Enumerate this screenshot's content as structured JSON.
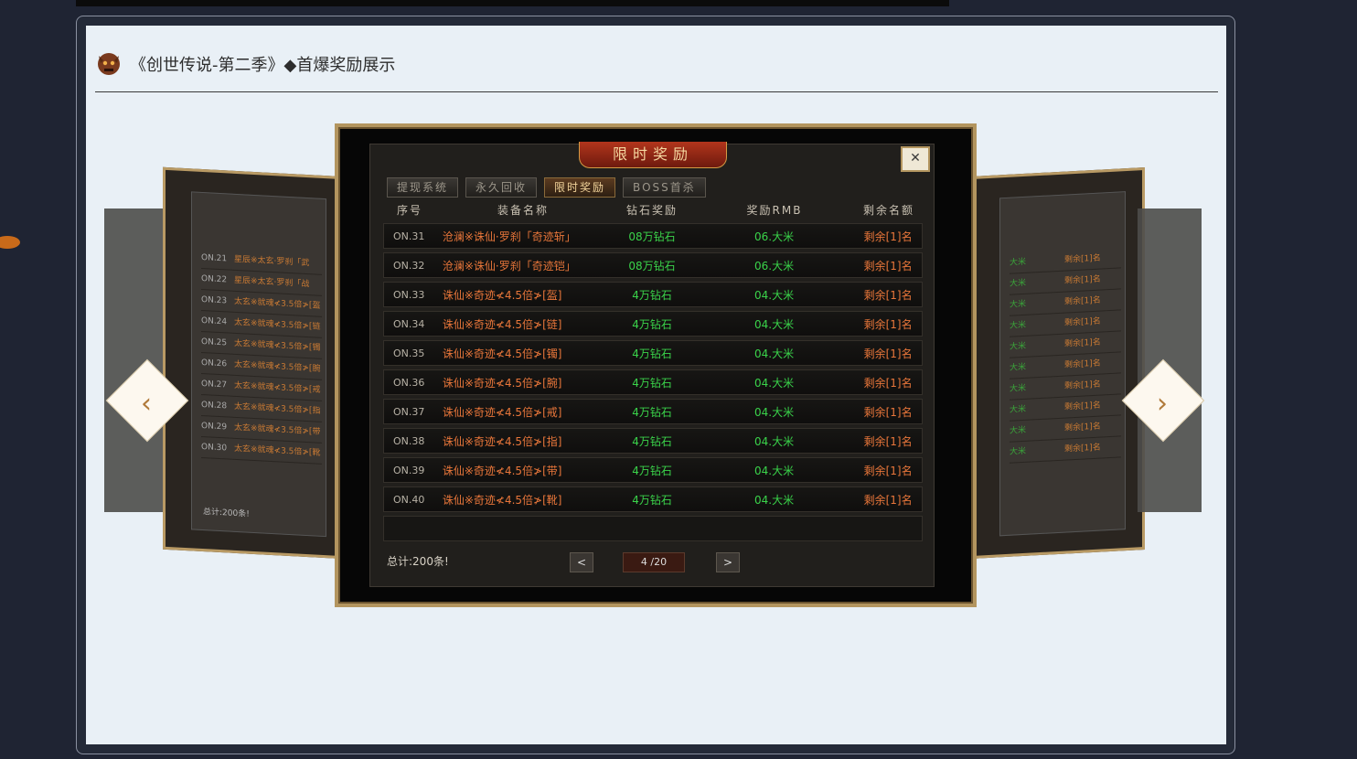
{
  "header": {
    "title": "《创世传说-第二季》◆首爆奖励展示"
  },
  "modal": {
    "banner": "限时奖励",
    "close": "✕",
    "tabs": [
      {
        "label": "提现系统"
      },
      {
        "label": "永久回收"
      },
      {
        "label": "限时奖励"
      },
      {
        "label": "BOSS首杀"
      }
    ],
    "columns": [
      "序号",
      "装备名称",
      "钻石奖励",
      "奖励RMB",
      "剩余名额"
    ],
    "rows": [
      {
        "no": "ON.31",
        "name": "沧澜※诛仙·罗刹「奇迹斩」",
        "diamond": "08万钻石",
        "rmb": "06.大米",
        "left": "剩余[1]名"
      },
      {
        "no": "ON.32",
        "name": "沧澜※诛仙·罗刹「奇迹铠」",
        "diamond": "08万钻石",
        "rmb": "06.大米",
        "left": "剩余[1]名"
      },
      {
        "no": "ON.33",
        "name": "诛仙※奇迹≮4.5倍≯[盔]",
        "diamond": "4万钻石",
        "rmb": "04.大米",
        "left": "剩余[1]名"
      },
      {
        "no": "ON.34",
        "name": "诛仙※奇迹≮4.5倍≯[链]",
        "diamond": "4万钻石",
        "rmb": "04.大米",
        "left": "剩余[1]名"
      },
      {
        "no": "ON.35",
        "name": "诛仙※奇迹≮4.5倍≯[镯]",
        "diamond": "4万钻石",
        "rmb": "04.大米",
        "left": "剩余[1]名"
      },
      {
        "no": "ON.36",
        "name": "诛仙※奇迹≮4.5倍≯[腕]",
        "diamond": "4万钻石",
        "rmb": "04.大米",
        "left": "剩余[1]名"
      },
      {
        "no": "ON.37",
        "name": "诛仙※奇迹≮4.5倍≯[戒]",
        "diamond": "4万钻石",
        "rmb": "04.大米",
        "left": "剩余[1]名"
      },
      {
        "no": "ON.38",
        "name": "诛仙※奇迹≮4.5倍≯[指]",
        "diamond": "4万钻石",
        "rmb": "04.大米",
        "left": "剩余[1]名"
      },
      {
        "no": "ON.39",
        "name": "诛仙※奇迹≮4.5倍≯[带]",
        "diamond": "4万钻石",
        "rmb": "04.大米",
        "left": "剩余[1]名"
      },
      {
        "no": "ON.40",
        "name": "诛仙※奇迹≮4.5倍≯[靴]",
        "diamond": "4万钻石",
        "rmb": "04.大米",
        "left": "剩余[1]名"
      }
    ],
    "total": "总计:200条!",
    "prev": "<",
    "next": ">",
    "page": "4 /20"
  },
  "side_left": {
    "total": "总计:200条!",
    "rows": [
      {
        "no": "ON.21",
        "name": "星辰※太玄·罗刹「武"
      },
      {
        "no": "ON.22",
        "name": "星辰※太玄·罗刹「战"
      },
      {
        "no": "ON.23",
        "name": "太玄※就魂≮3.5倍≯[盔"
      },
      {
        "no": "ON.24",
        "name": "太玄※就魂≮3.5倍≯[链"
      },
      {
        "no": "ON.25",
        "name": "太玄※就魂≮3.5倍≯[镯"
      },
      {
        "no": "ON.26",
        "name": "太玄※就魂≮3.5倍≯[腕"
      },
      {
        "no": "ON.27",
        "name": "太玄※就魂≮3.5倍≯[戒"
      },
      {
        "no": "ON.28",
        "name": "太玄※就魂≮3.5倍≯[指"
      },
      {
        "no": "ON.29",
        "name": "太玄※就魂≮3.5倍≯[带"
      },
      {
        "no": "ON.30",
        "name": "太玄※就魂≮3.5倍≯[靴"
      }
    ]
  },
  "side_right": {
    "rows": [
      {
        "rmb": "大米",
        "left": "剩余[1]名"
      },
      {
        "rmb": "大米",
        "left": "剩余[1]名"
      },
      {
        "rmb": "大米",
        "left": "剩余[1]名"
      },
      {
        "rmb": "大米",
        "left": "剩余[1]名"
      },
      {
        "rmb": "大米",
        "left": "剩余[1]名"
      },
      {
        "rmb": "大米",
        "left": "剩余[1]名"
      },
      {
        "rmb": "大米",
        "left": "剩余[1]名"
      },
      {
        "rmb": "大米",
        "left": "剩余[1]名"
      },
      {
        "rmb": "大米",
        "left": "剩余[1]名"
      },
      {
        "rmb": "大米",
        "left": "剩余[1]名"
      }
    ]
  },
  "colors": {
    "accent_gold": "#b3955f",
    "item_orange": "#e8763a",
    "reward_green": "#3ad34a",
    "panel_bg": "#e9f0f6"
  },
  "icons": {
    "logo": "demon-head-icon",
    "carousel_prev": "arrow-left-icon",
    "carousel_next": "arrow-right-icon"
  }
}
